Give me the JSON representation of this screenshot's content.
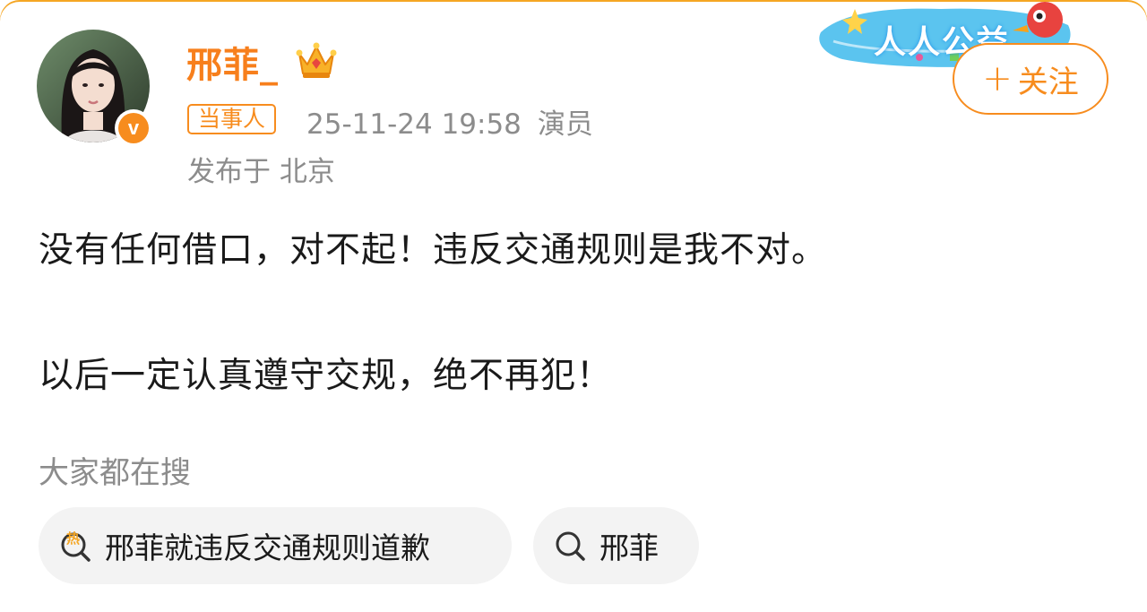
{
  "post": {
    "username": "邢菲_",
    "tag": "当事人",
    "datetime": "25-11-24 19:58",
    "role": "演员",
    "location": "发布于 北京",
    "follow_label": "关注",
    "banner_text": "人人公益",
    "line1": "没有任何借口，对不起！违反交通规则是我不对。",
    "line2": "以后一定认真遵守交规，绝不再犯！"
  },
  "search": {
    "title": "大家都在搜",
    "items": [
      {
        "label": "邢菲就违反交通规则道歉",
        "icon": "hot-search-icon"
      },
      {
        "label": "邢菲",
        "icon": "search-icon"
      }
    ]
  },
  "colors": {
    "accent": "#f78c1e",
    "username": "#f77f1c",
    "muted": "#8c8c8c",
    "text": "#1a1a1a",
    "pill_bg": "#f3f3f3"
  }
}
